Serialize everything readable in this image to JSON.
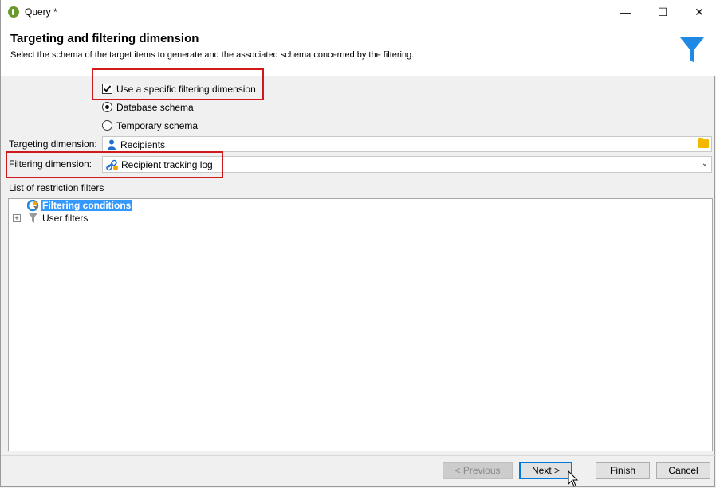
{
  "window": {
    "title": "Query *",
    "controls": {
      "minimize": "—",
      "maximize": "☐",
      "close": "✕"
    }
  },
  "header": {
    "title": "Targeting and filtering dimension",
    "subtitle": "Select the schema of the target items to  generate and the associated schema concerned by the filtering.",
    "icon": "funnel-icon"
  },
  "options": {
    "use_specific_filtering": {
      "label": "Use a specific filtering dimension",
      "checked": true
    },
    "schema_choice": [
      {
        "label": "Database schema",
        "selected": true
      },
      {
        "label": "Temporary schema",
        "selected": false
      }
    ]
  },
  "targeting": {
    "label": "Targeting dimension:",
    "value": "Recipients",
    "icon": "person-icon"
  },
  "filtering": {
    "label": "Filtering dimension:",
    "value": "Recipient tracking log",
    "icon": "link-icon"
  },
  "restrictions": {
    "group_label": "List of restriction filters",
    "items": [
      {
        "label": "Filtering conditions",
        "selected": true,
        "icon": "filter-conditions-icon"
      },
      {
        "label": "User filters",
        "selected": false,
        "icon": "funnel-icon",
        "expandable": true
      }
    ]
  },
  "footer": {
    "previous": "< Previous",
    "next": "Next >",
    "finish": "Finish",
    "cancel": "Cancel"
  },
  "colors": {
    "highlight": "#d0191a",
    "accent": "#1e8ae6",
    "selection": "#3399ff"
  }
}
